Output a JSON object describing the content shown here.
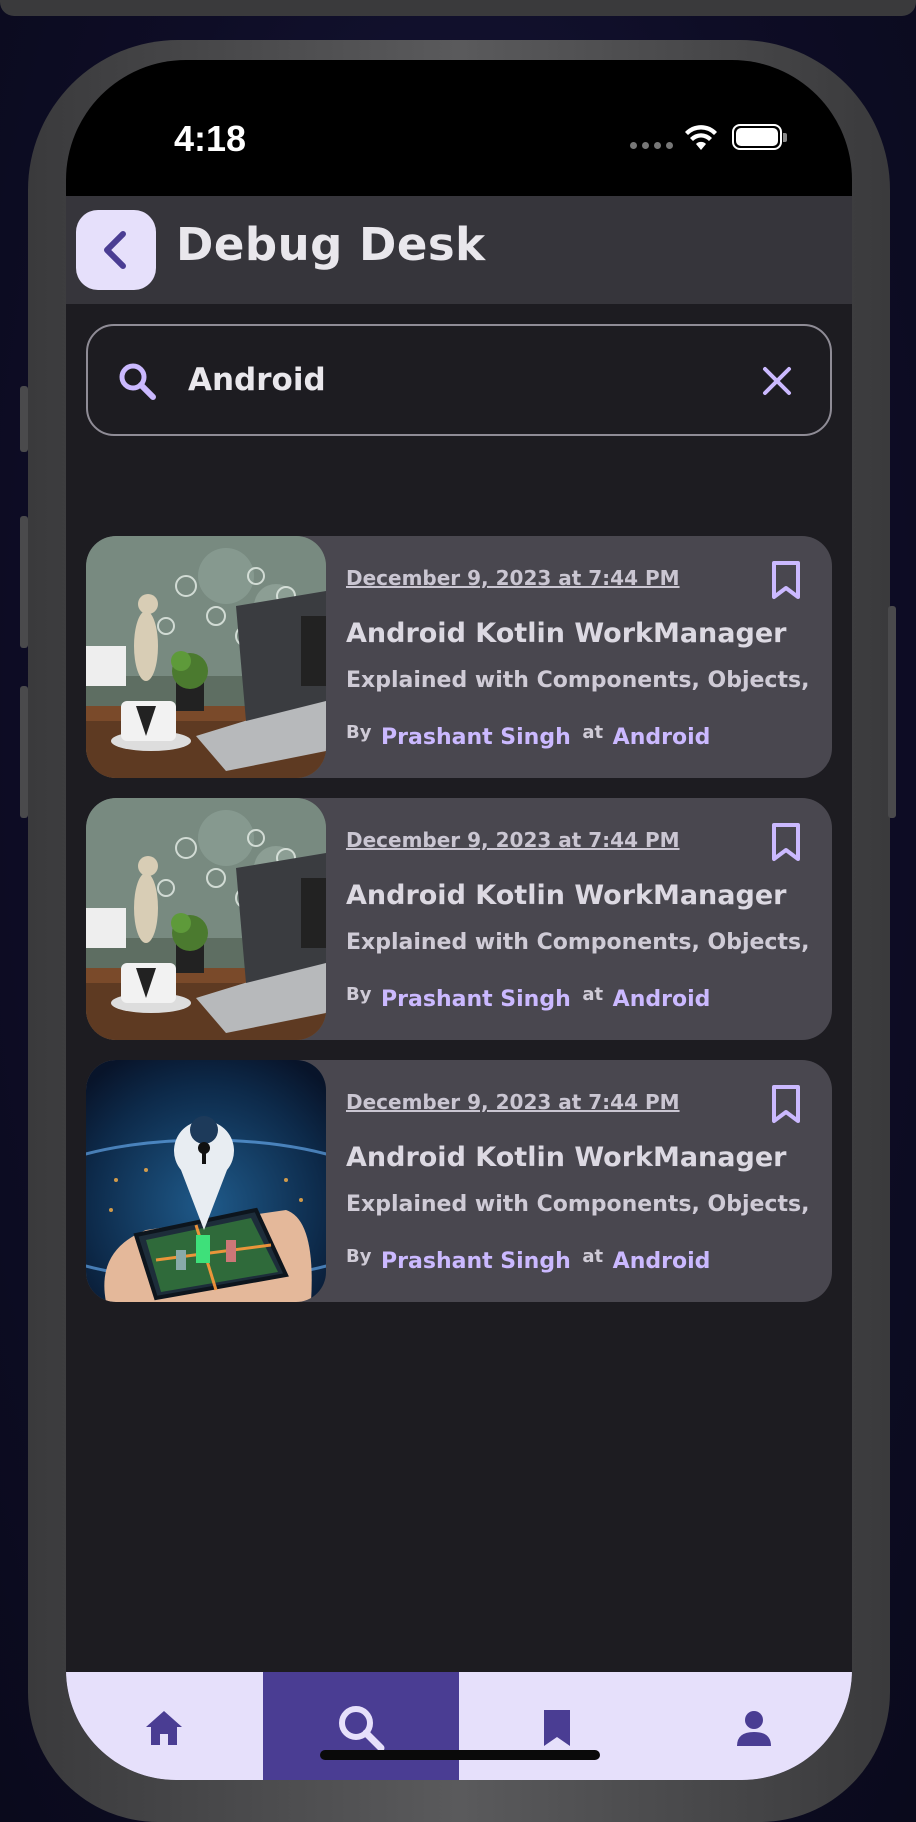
{
  "status_bar": {
    "time": "4:18"
  },
  "header": {
    "title": "Debug Desk"
  },
  "search": {
    "value": "Android",
    "placeholder": ""
  },
  "articles": [
    {
      "date": "December 9, 2023 at 7:44 PM",
      "title": "Android Kotlin WorkManager",
      "subtitle": "Explained with Components, Objects,",
      "by_label": "By",
      "author": "Prashant Singh",
      "at_label": "at",
      "category": "Android",
      "image": "desk-laptop-figurine-image"
    },
    {
      "date": "December 9, 2023 at 7:44 PM",
      "title": "Android Kotlin WorkManager",
      "subtitle": "Explained with Components, Objects,",
      "by_label": "By",
      "author": "Prashant Singh",
      "at_label": "at",
      "category": "Android",
      "image": "desk-laptop-figurine-image"
    },
    {
      "date": "December 9, 2023 at 7:44 PM",
      "title": "Android Kotlin WorkManager",
      "subtitle": "Explained with Components, Objects,",
      "by_label": "By",
      "author": "Prashant Singh",
      "at_label": "at",
      "category": "Android",
      "image": "location-pin-phone-city-image"
    }
  ],
  "bottom_nav": {
    "items": [
      "home-icon",
      "search-icon",
      "bookmark-icon",
      "person-icon"
    ],
    "active": "search-icon"
  },
  "colors": {
    "accent": "#4a3d93",
    "accent_light": "#e6e0fb",
    "link": "#cbb9ff",
    "background": "#1d1c21",
    "card": "#49474f"
  }
}
